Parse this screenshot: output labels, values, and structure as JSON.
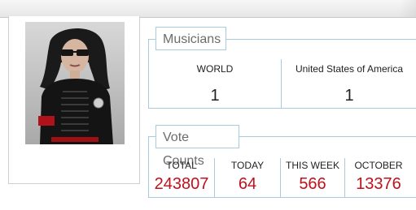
{
  "musicians": {
    "legend": "Musicians",
    "columns": [
      {
        "label": "WORLD",
        "value": "1"
      },
      {
        "label": "United States of America",
        "value": "1"
      }
    ]
  },
  "votes": {
    "legend": "Vote Counts",
    "columns": [
      {
        "label": "TOTAL",
        "value": "243807"
      },
      {
        "label": "TODAY",
        "value": "64"
      },
      {
        "label": "THIS WEEK",
        "value": "566"
      },
      {
        "label": "OCTOBER",
        "value": "13376"
      }
    ],
    "value_color": "#c0101a"
  },
  "colors": {
    "panel_border": "#a9cbe0",
    "legend_text": "#6c6c6c"
  }
}
